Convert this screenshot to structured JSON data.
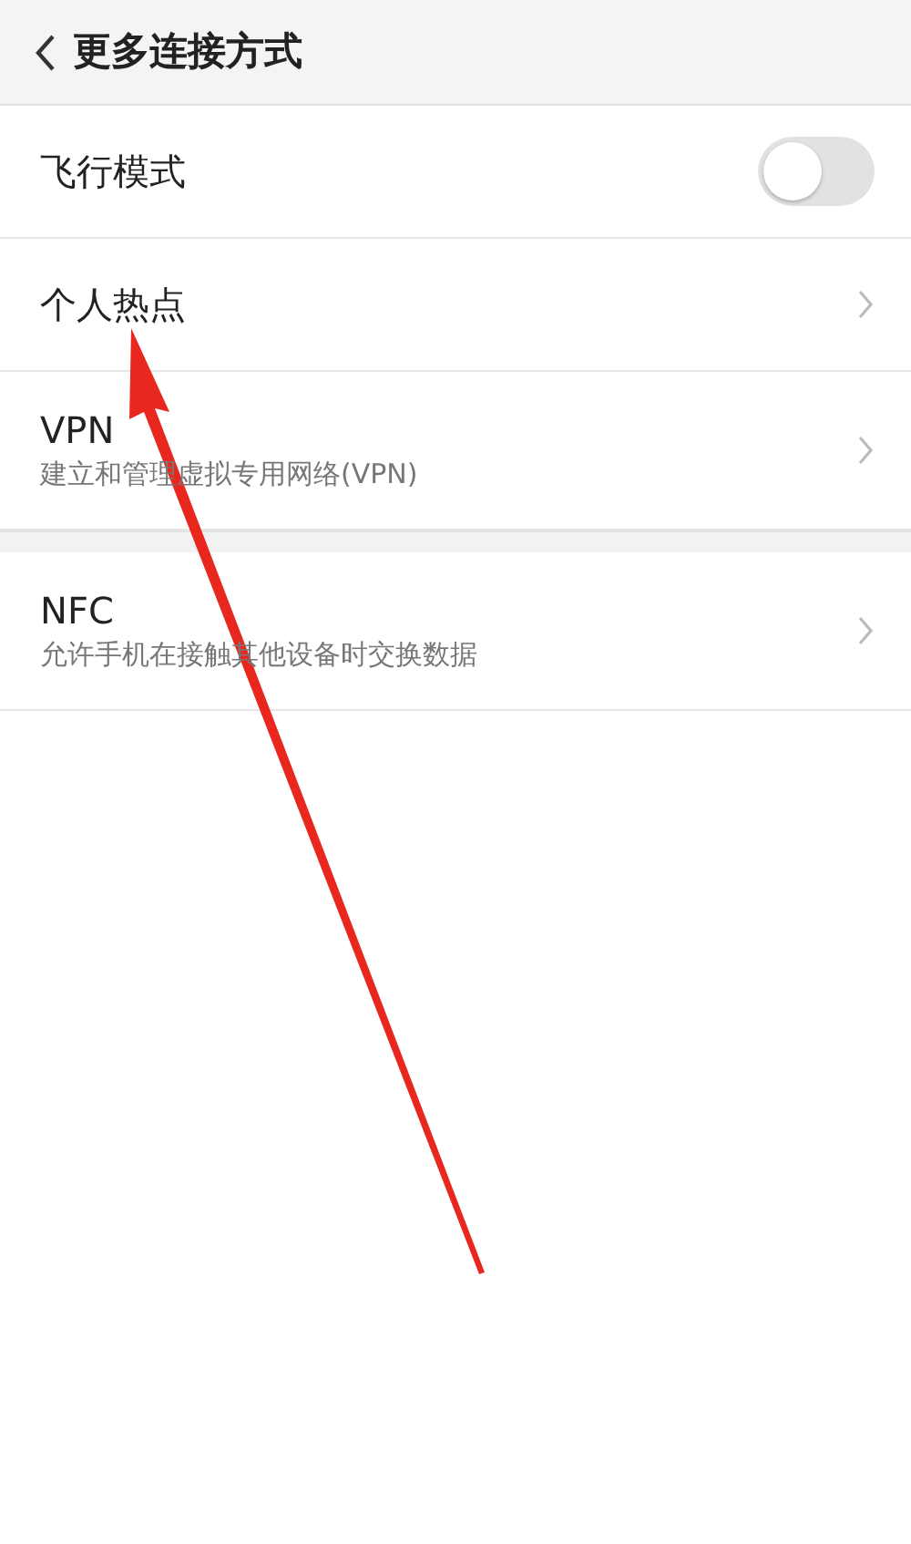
{
  "header": {
    "title": "更多连接方式"
  },
  "sections": [
    {
      "items": [
        {
          "kind": "toggle",
          "title": "飞行模式",
          "on": false
        },
        {
          "kind": "link",
          "title": "个人热点"
        },
        {
          "kind": "link",
          "title": "VPN",
          "subtitle": "建立和管理虚拟专用网络(VPN)"
        }
      ]
    },
    {
      "items": [
        {
          "kind": "link",
          "title": "NFC",
          "subtitle": "允许手机在接触其他设备时交换数据"
        }
      ]
    }
  ]
}
